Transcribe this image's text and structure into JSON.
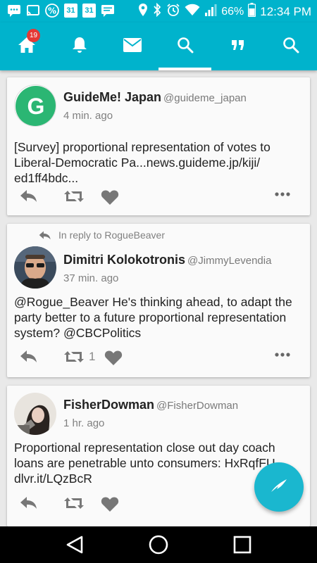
{
  "status_bar": {
    "battery": "66%",
    "time": "12:34 PM",
    "calendar_day_1": "31",
    "calendar_day_2": "31"
  },
  "nav": {
    "notification_badge": "19",
    "active_tab": "search"
  },
  "tweets": [
    {
      "avatar_letter": "G",
      "name": "GuideMe! Japan",
      "handle": "@guideme_japan",
      "time": "4 min. ago",
      "text_lines": [
        "[Survey] proportional representation of votes to",
        "Liberal-Democratic Pa...news.guideme.jp/kiji/",
        "ed1ff4bdc..."
      ]
    },
    {
      "reply_context": "In reply to RogueBeaver",
      "name": "Dimitri Kolokotronis",
      "handle": "@JimmyLevendia",
      "time": "37 min. ago",
      "retweet_count": "1",
      "text_lines": [
        "@Rogue_Beaver He's thinking ahead, to adapt the",
        "party better to a future proportional representation",
        "system? @CBCPolitics"
      ]
    },
    {
      "name": "FisherDowman",
      "handle": "@FisherDowman",
      "time": "1 hr. ago",
      "text_lines": [
        "Proportional representation close out day coach",
        "loans are penetrable unto consumers: HxRqfFU",
        "dlvr.it/LQzBcR"
      ]
    }
  ],
  "colors": {
    "accent": "#00b3cc",
    "fab": "#1ab7cf",
    "badge": "#e53935",
    "guideme_green": "#2bb673",
    "icon_gray": "#777777"
  }
}
